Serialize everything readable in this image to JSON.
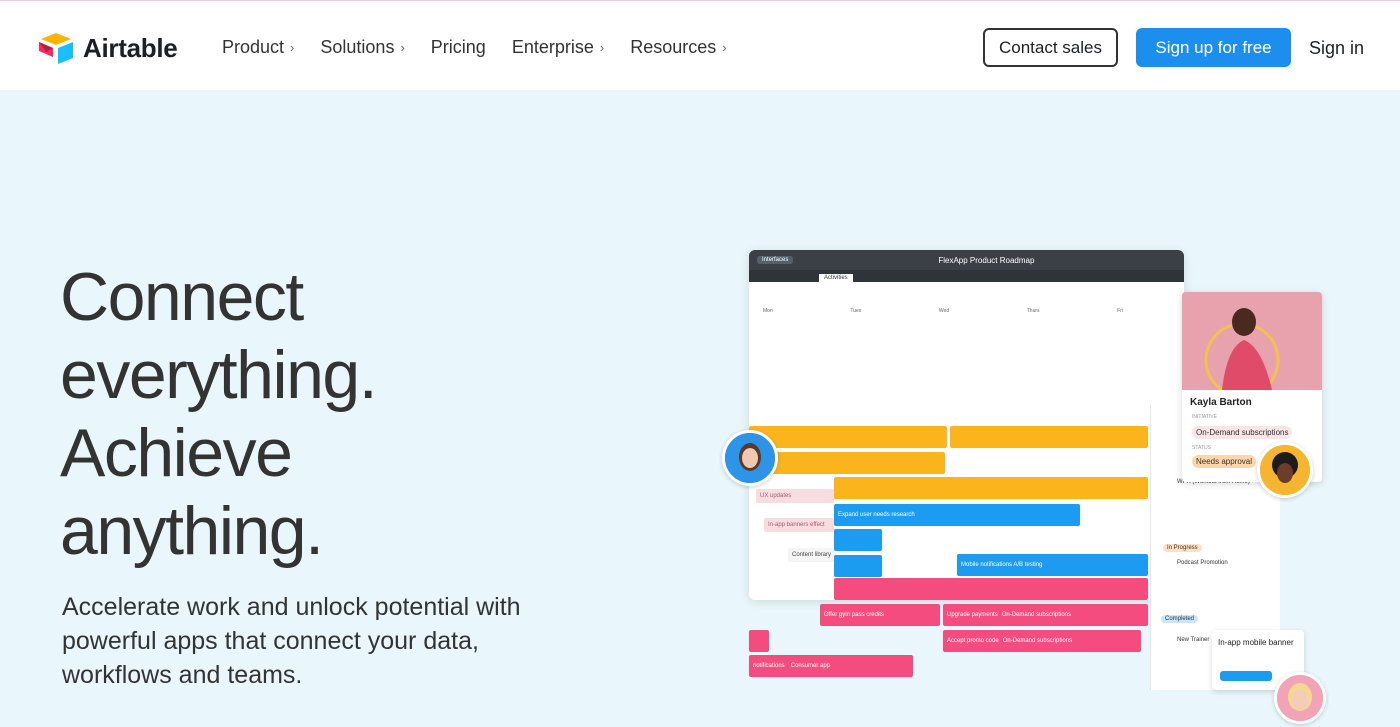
{
  "nav": {
    "brand": "Airtable",
    "links": [
      {
        "label": "Product",
        "chevron": true
      },
      {
        "label": "Solutions",
        "chevron": true
      },
      {
        "label": "Pricing",
        "chevron": false
      },
      {
        "label": "Enterprise",
        "chevron": true
      },
      {
        "label": "Resources",
        "chevron": true
      }
    ],
    "contact_label": "Contact sales",
    "signup_label": "Sign up for free",
    "signin_label": "Sign in"
  },
  "hero": {
    "headline_lines": [
      "Connect",
      "everything.",
      "Achieve",
      "anything."
    ],
    "subhead_lines": [
      "Accelerate work and unlock potential with",
      "powerful apps that connect your data,",
      "workflows and teams."
    ]
  },
  "mock": {
    "pill": "Interfaces",
    "title": "FlexApp Product Roadmap",
    "tab": "Activities",
    "days": [
      "Mon",
      "Tues",
      "Wed",
      "Thurs",
      "Fri"
    ],
    "bars": [
      {
        "label": "UX updates"
      },
      {
        "label": "Expand user needs research"
      },
      {
        "label": "In-app banners effect"
      },
      {
        "label": "Content library"
      },
      {
        "label": "Mobile notifications A/B testing"
      },
      {
        "label": "Offer gym pass credits"
      },
      {
        "label": "Upgrade payments"
      },
      {
        "label": "On-Demand subscriptions"
      },
      {
        "label": "Accept promo code"
      },
      {
        "label": "On-Demand subscriptions"
      },
      {
        "label": "notifications"
      },
      {
        "label": "Consumer app"
      }
    ],
    "right_items": [
      "WFH (Workout from Home)",
      "In Progress",
      "Podcast Promotion",
      "Completed",
      "New Trainer"
    ]
  },
  "profile": {
    "name": "Kayla Barton",
    "initiative_label": "INITIATIVE",
    "initiative": "On-Demand subscriptions",
    "status_label": "STATUS",
    "status": "Needs approval"
  },
  "banner": {
    "title": "In-app mobile banner"
  },
  "colors": {
    "brand_blue": "#1c8fee",
    "hero_bg": "#e9f7fc",
    "yellow": "#fcb41c",
    "blue": "#1c9cf0",
    "pink": "#f54c80"
  }
}
